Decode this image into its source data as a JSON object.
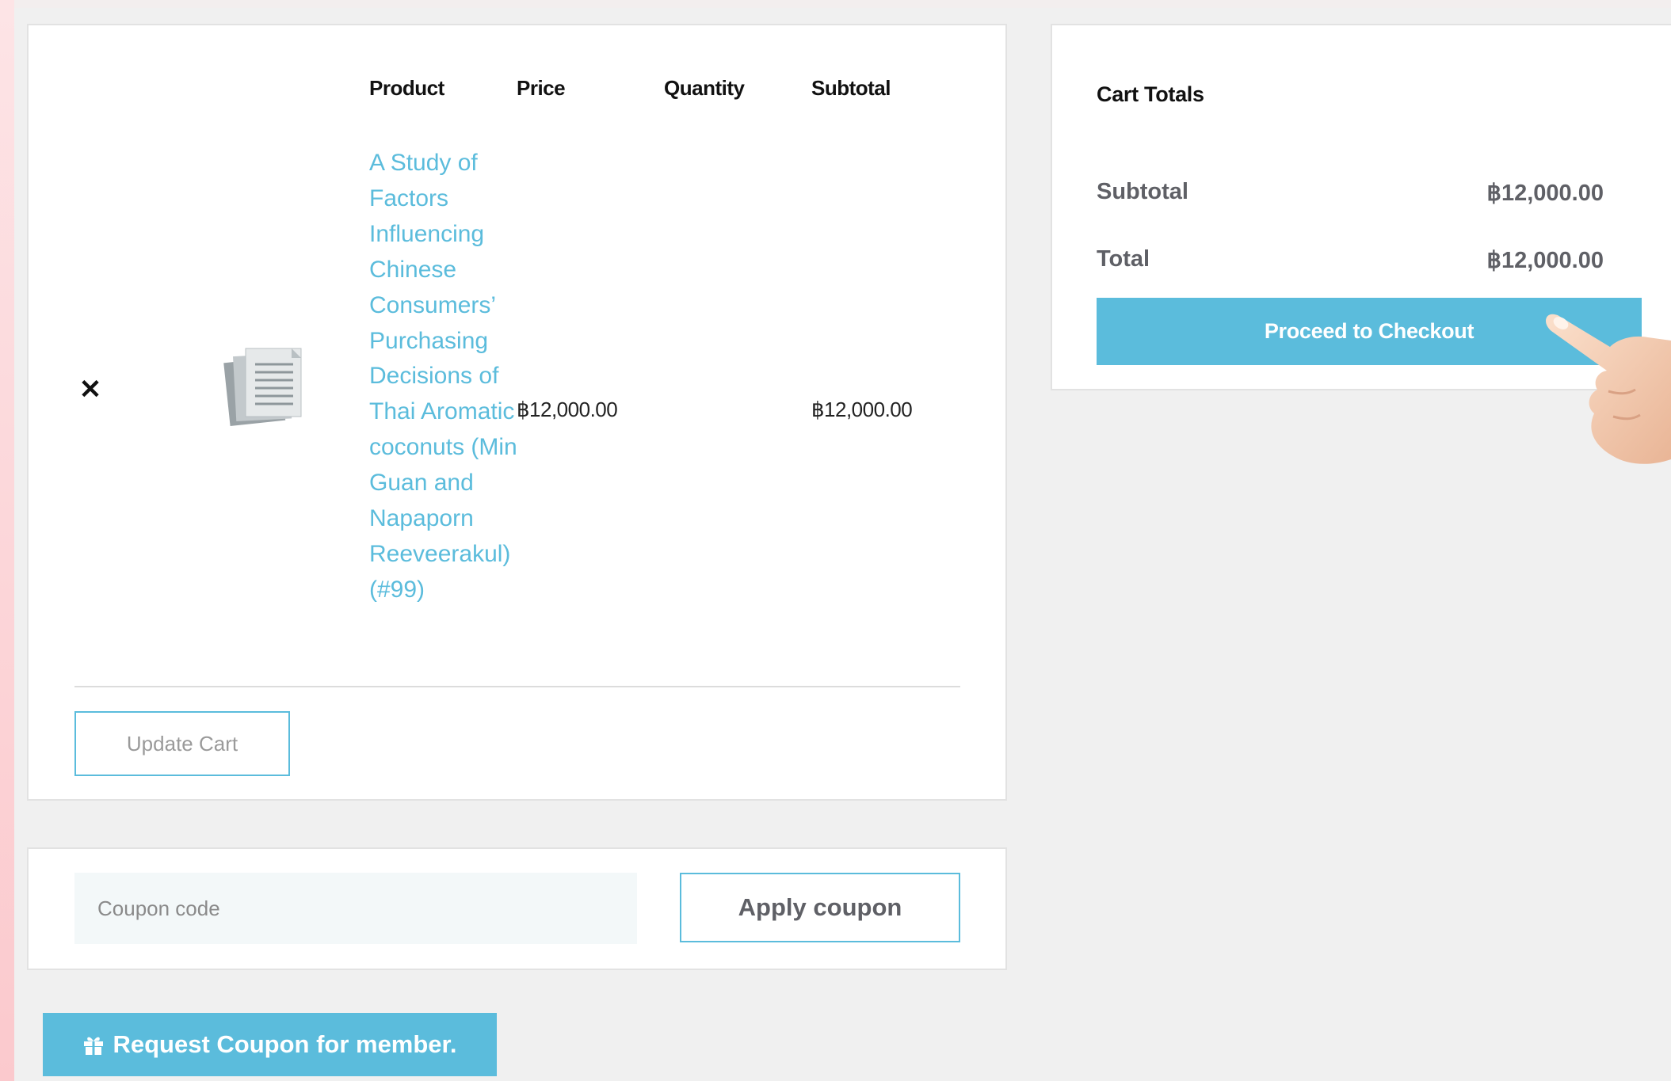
{
  "colors": {
    "accent": "#5bbcdc",
    "link": "#5bbcdc",
    "panel_bg": "#ffffff",
    "page_bg": "#f0f0f0"
  },
  "cart_table": {
    "headers": {
      "product": "Product",
      "price": "Price",
      "quantity": "Quantity",
      "subtotal": "Subtotal"
    },
    "rows": [
      {
        "remove_icon": "close-icon",
        "thumbnail_icon": "document-stack-icon",
        "product_name": "A Study of Factors Influencing Chinese Consumers’ Purchasing Decisions of Thai Aromatic coconuts (Min Guan and Napaporn Reeveerakul) (#99)",
        "price": "฿12,000.00",
        "quantity": "",
        "subtotal": "฿12,000.00"
      }
    ],
    "update_cart_label": "Update Cart"
  },
  "coupon": {
    "placeholder": "Coupon code",
    "value": "",
    "apply_label": "Apply coupon"
  },
  "request_coupon": {
    "icon": "gift-icon",
    "label": "Request Coupon for member."
  },
  "cart_totals": {
    "title": "Cart Totals",
    "subtotal_label": "Subtotal",
    "subtotal_value": "฿12,000.00",
    "total_label": "Total",
    "total_value": "฿12,000.00",
    "checkout_label": "Proceed to Checkout",
    "pointer_icon": "pointing-hand-icon"
  }
}
